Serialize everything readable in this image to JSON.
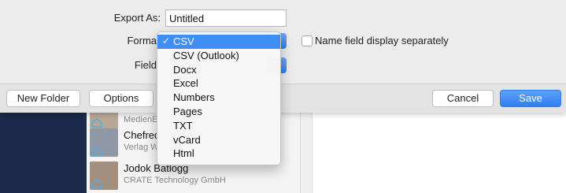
{
  "export_form": {
    "export_as_label": "Export As:",
    "filename_value": "Untitled",
    "format_label": "Forma",
    "fields_label": "Field",
    "name_field_checkbox_label": "Name field display separately"
  },
  "format_menu": {
    "items": [
      {
        "label": "CSV",
        "selected": true
      },
      {
        "label": "CSV (Outlook)"
      },
      {
        "label": "Docx"
      },
      {
        "label": "Excel"
      },
      {
        "label": "Numbers"
      },
      {
        "label": "Pages"
      },
      {
        "label": "TXT"
      },
      {
        "label": "vCard"
      },
      {
        "label": "Html"
      }
    ],
    "check_glyph": "✓"
  },
  "buttons": {
    "new_folder": "New Folder",
    "options": "Options",
    "cancel": "Cancel",
    "save": "Save"
  },
  "contacts": [
    {
      "name": "",
      "org": "MedienE"
    },
    {
      "name": "Chefred",
      "org": "Verlag W"
    },
    {
      "name": "Jodok Batlogg",
      "org": "CRATE Technology GmbH"
    }
  ],
  "colors": {
    "accent": "#3f8ef5",
    "sidebar": "#1b2a4a"
  },
  "icons": {
    "popup_arrows": "chevron-up-down-icon",
    "checkmark": "checkmark-icon",
    "contact_thumb": "house-icon"
  }
}
